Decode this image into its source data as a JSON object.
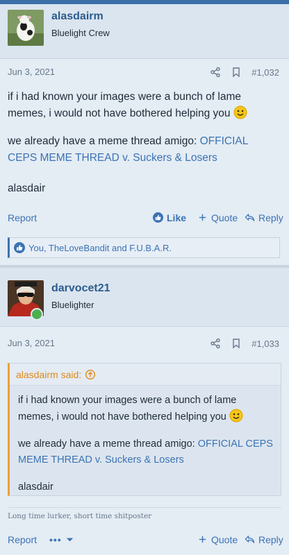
{
  "posts": [
    {
      "username": "alasdairm",
      "user_title": "Bluelight Crew",
      "date": "Jun 3, 2021",
      "post_number": "#1,032",
      "body": {
        "p1": "if i had known your images were a bunch of lame memes, i would not have bothered helping you",
        "p2_text": "we already have a meme thread amigo: ",
        "p2_link": "OFFICIAL CEPS MEME THREAD v. Suckers & Losers",
        "p3": "alasdair"
      },
      "actions": {
        "report": "Report",
        "like": "Like",
        "quote": "Quote",
        "reply": "Reply"
      },
      "reactions": "You, TheLoveBandit and F.U.B.A.R."
    },
    {
      "username": "darvocet21",
      "user_title": "Bluelighter",
      "date": "Jun 3, 2021",
      "post_number": "#1,033",
      "quote": {
        "author": "alasdairm said:",
        "p1": "if i had known your images were a bunch of lame memes, i would not have bothered helping you",
        "p2_text": "we already have a meme thread amigo: ",
        "p2_link": "OFFICIAL CEPS MEME THREAD v. Suckers & Losers",
        "p3": "alasdair"
      },
      "signature": "Long time lurker, short time shitposter",
      "actions": {
        "report": "Report",
        "more": "•••",
        "quote": "Quote",
        "reply": "Reply"
      }
    }
  ],
  "colors": {
    "accent": "#3b73b3",
    "quote_border": "#e9a13b",
    "online": "#4caf50"
  },
  "icons": [
    "share-icon",
    "bookmark-icon",
    "like-icon",
    "plus-icon",
    "reply-icon",
    "smiley-icon",
    "arrow-up-circle-icon",
    "chevron-down-icon"
  ]
}
